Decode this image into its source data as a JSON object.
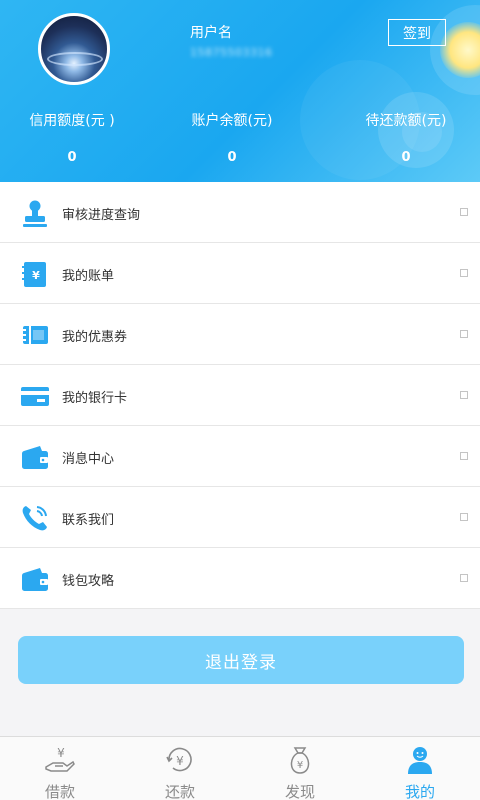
{
  "colors": {
    "primary": "#1aa7f0",
    "logout_bg": "#79d1fb",
    "tab_active": "#2ba8f0",
    "tab_inactive": "#8a8a8a"
  },
  "profile": {
    "username": "用户名",
    "phone": "15875503316",
    "signin_label": "签到"
  },
  "stats": [
    {
      "label": "信用额度(元 )",
      "value": "0"
    },
    {
      "label": "账户余额(元)",
      "value": "0"
    },
    {
      "label": "待还款额(元)",
      "value": "0"
    }
  ],
  "menu": [
    {
      "label": "审核进度查询",
      "icon": "stamp-icon"
    },
    {
      "label": "我的账单",
      "icon": "bill-notebook-icon"
    },
    {
      "label": "我的优惠券",
      "icon": "coupon-ticket-icon"
    },
    {
      "label": "我的银行卡",
      "icon": "bank-card-icon"
    },
    {
      "label": "消息中心",
      "icon": "wallet-icon"
    },
    {
      "label": "联系我们",
      "icon": "phone-icon"
    },
    {
      "label": "钱包攻略",
      "icon": "wallet-icon"
    }
  ],
  "logout_label": "退出登录",
  "tabs": [
    {
      "label": "借款",
      "icon": "hand-coin-icon"
    },
    {
      "label": "还款",
      "icon": "yen-circle-icon"
    },
    {
      "label": "发现",
      "icon": "money-bag-icon"
    },
    {
      "label": "我的",
      "icon": "person-icon"
    }
  ]
}
